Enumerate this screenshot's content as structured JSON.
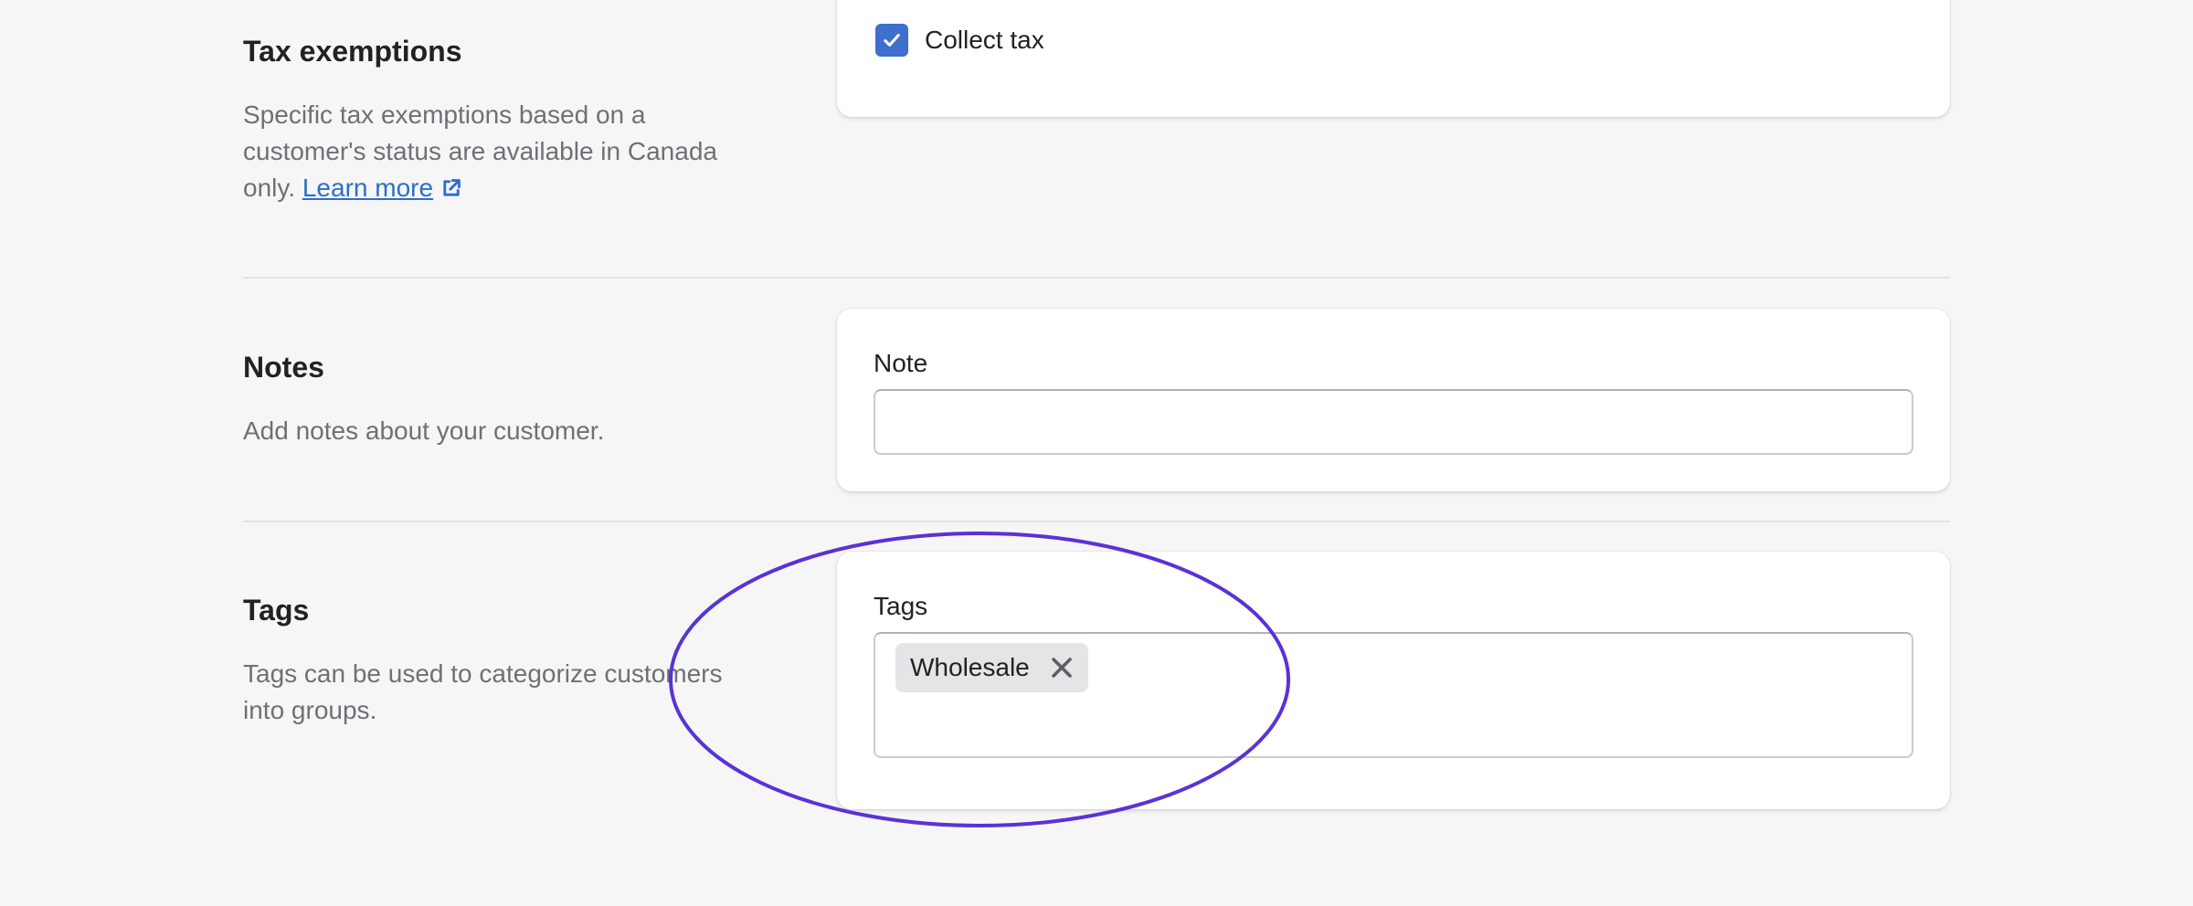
{
  "tax_section": {
    "title": "Tax exemptions",
    "description": "Specific tax exemptions based on a customer's status are available in Canada only.",
    "learn_more": "Learn more",
    "collect_tax_label": "Collect tax",
    "collect_tax_checked": true
  },
  "notes_section": {
    "title": "Notes",
    "description": "Add notes about your customer.",
    "note_label": "Note",
    "note_value": ""
  },
  "tags_section": {
    "title": "Tags",
    "description": "Tags can be used to categorize customers into groups.",
    "tags_label": "Tags",
    "tags": [
      "Wholesale"
    ]
  },
  "colors": {
    "accent": "#3e6fcc",
    "link": "#2c6ecb",
    "annotation": "#5a32d6",
    "background": "#f6f6f7"
  },
  "icons": {
    "checkbox": "checkmark-icon",
    "learn_more": "external-link-icon",
    "tag_remove": "close-icon"
  }
}
